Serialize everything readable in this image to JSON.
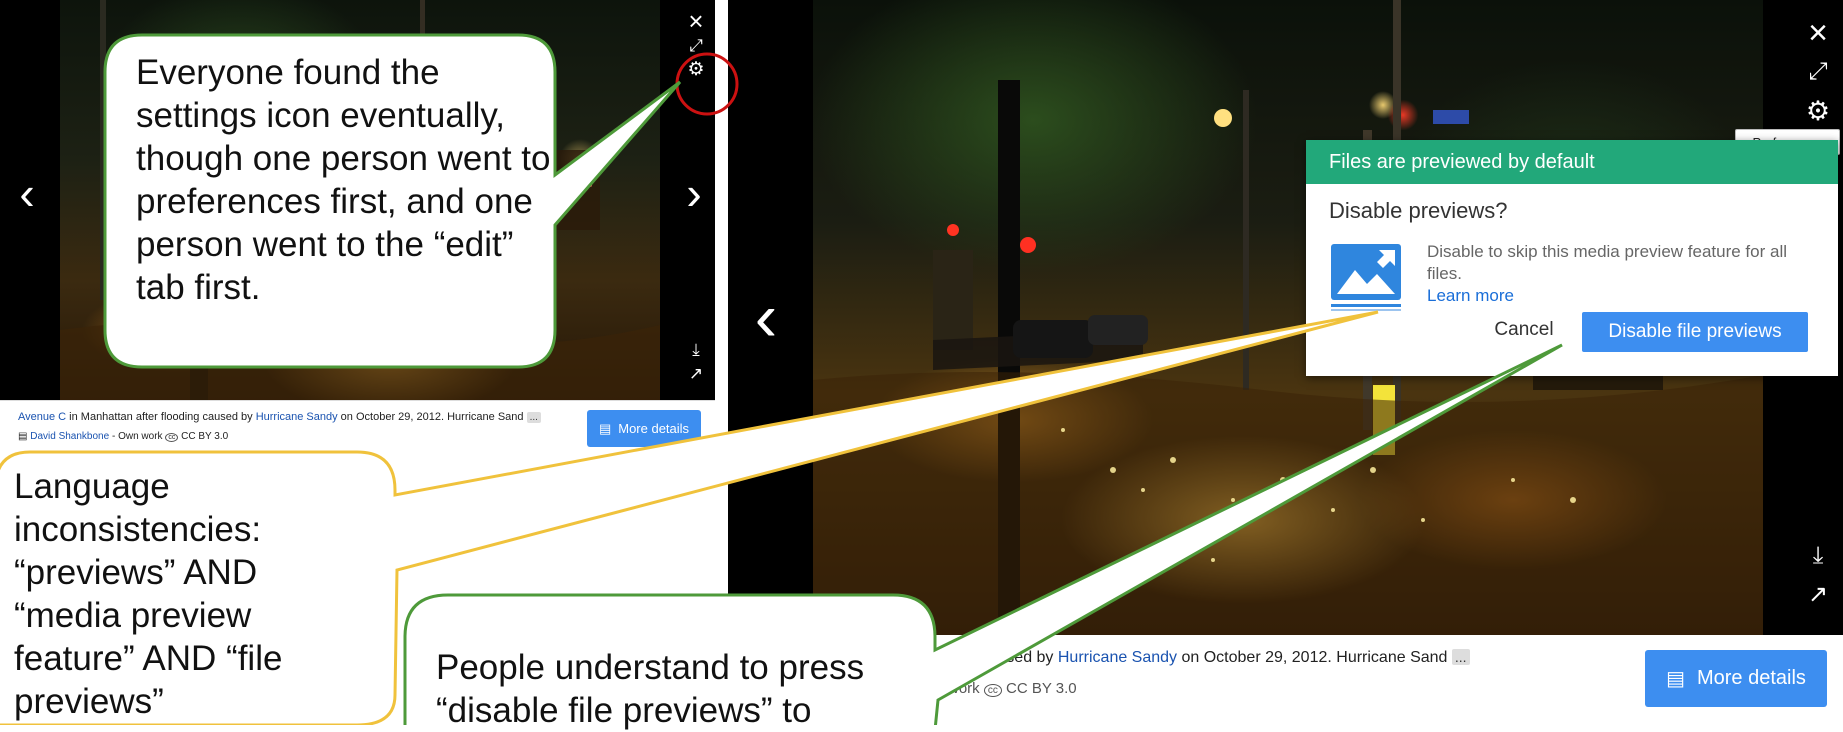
{
  "left_viewer": {
    "caption": {
      "link1": "Avenue C",
      "text1": " in Manhattan after flooding caused by ",
      "link2": "Hurricane Sandy",
      "text2": " on October 29, 2012. Hurricane Sand",
      "ellipsis": "...",
      "author": "David Shankbone",
      "source": " - Own work",
      "license_icon": "cc",
      "license": "CC BY 3.0"
    },
    "more_details_label": "More details"
  },
  "right_viewer": {
    "caption": {
      "text1": "ooding caused by ",
      "link": "Hurricane Sandy",
      "text2": " on October 29, 2012. Hurricane Sand",
      "ellipsis": "...",
      "source": "vn work",
      "license_icon": "cc",
      "license": "CC BY 3.0"
    },
    "more_details_label": "More details",
    "tooltip": "Preferences"
  },
  "icons": {
    "close": "×",
    "expand": "⤢",
    "gear": "⚙",
    "prev": "‹",
    "next": "›",
    "download": "⤓",
    "share": "↗",
    "details": "▤"
  },
  "dialog": {
    "header": "Files are previewed by default",
    "question": "Disable previews?",
    "body": "Disable to skip this media preview feature for all files.",
    "learn_more": "Learn more",
    "cancel": "Cancel",
    "disable": "Disable file previews"
  },
  "callouts": {
    "settings": "Everyone found the settings icon eventually, though one person went to preferences first, and one person went to the “edit” tab first.",
    "language": "Language inconsistencies: “previews”  AND “media preview feature” AND “file previews”",
    "press": "People understand to press “disable file previews” to"
  },
  "colors": {
    "green_callout": "#4e9a3a",
    "yellow_callout": "#f0c23c",
    "header_green": "#22a87a",
    "button_blue": "#3d8ef0",
    "circle_red": "#cc1111"
  }
}
